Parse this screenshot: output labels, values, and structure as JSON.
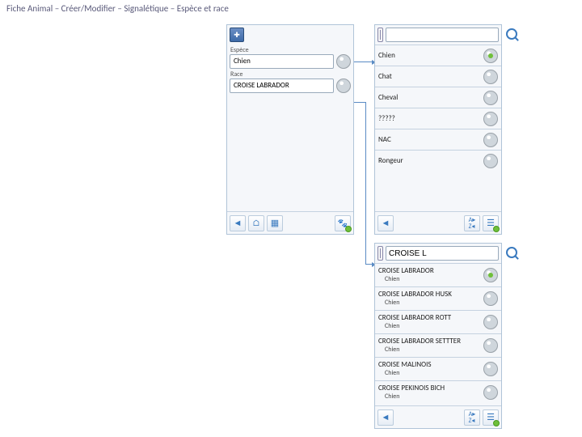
{
  "title": "Fiche Animal – Créer/Modifier – Signalétique – Espèce et race",
  "leftPanel": {
    "field1": {
      "label": "Espèce",
      "value": "Chien"
    },
    "field2": {
      "label": "Race",
      "value": "CROISE LABRADOR"
    }
  },
  "speciesSearch": "",
  "species": [
    {
      "label": "Chien",
      "selected": true
    },
    {
      "label": "Chat",
      "selected": false
    },
    {
      "label": "Cheval",
      "selected": false
    },
    {
      "label": "?????",
      "selected": false
    },
    {
      "label": "NAC",
      "selected": false
    },
    {
      "label": "Rongeur",
      "selected": false
    }
  ],
  "raceSearch": "CROISE L",
  "races": [
    {
      "label": "CROISE LABRADOR",
      "sub": "Chien",
      "selected": true
    },
    {
      "label": "CROISE LABRADOR HUSK",
      "sub": "Chien",
      "selected": false
    },
    {
      "label": "CROISE LABRADOR ROTT",
      "sub": "Chien",
      "selected": false
    },
    {
      "label": "CROISE LABRADOR SETTTER",
      "sub": "Chien",
      "selected": false
    },
    {
      "label": "CROISE MALINOIS",
      "sub": "Chien",
      "selected": false
    },
    {
      "label": "CROISE PEKINOIS BICH",
      "sub": "Chien",
      "selected": false
    }
  ]
}
